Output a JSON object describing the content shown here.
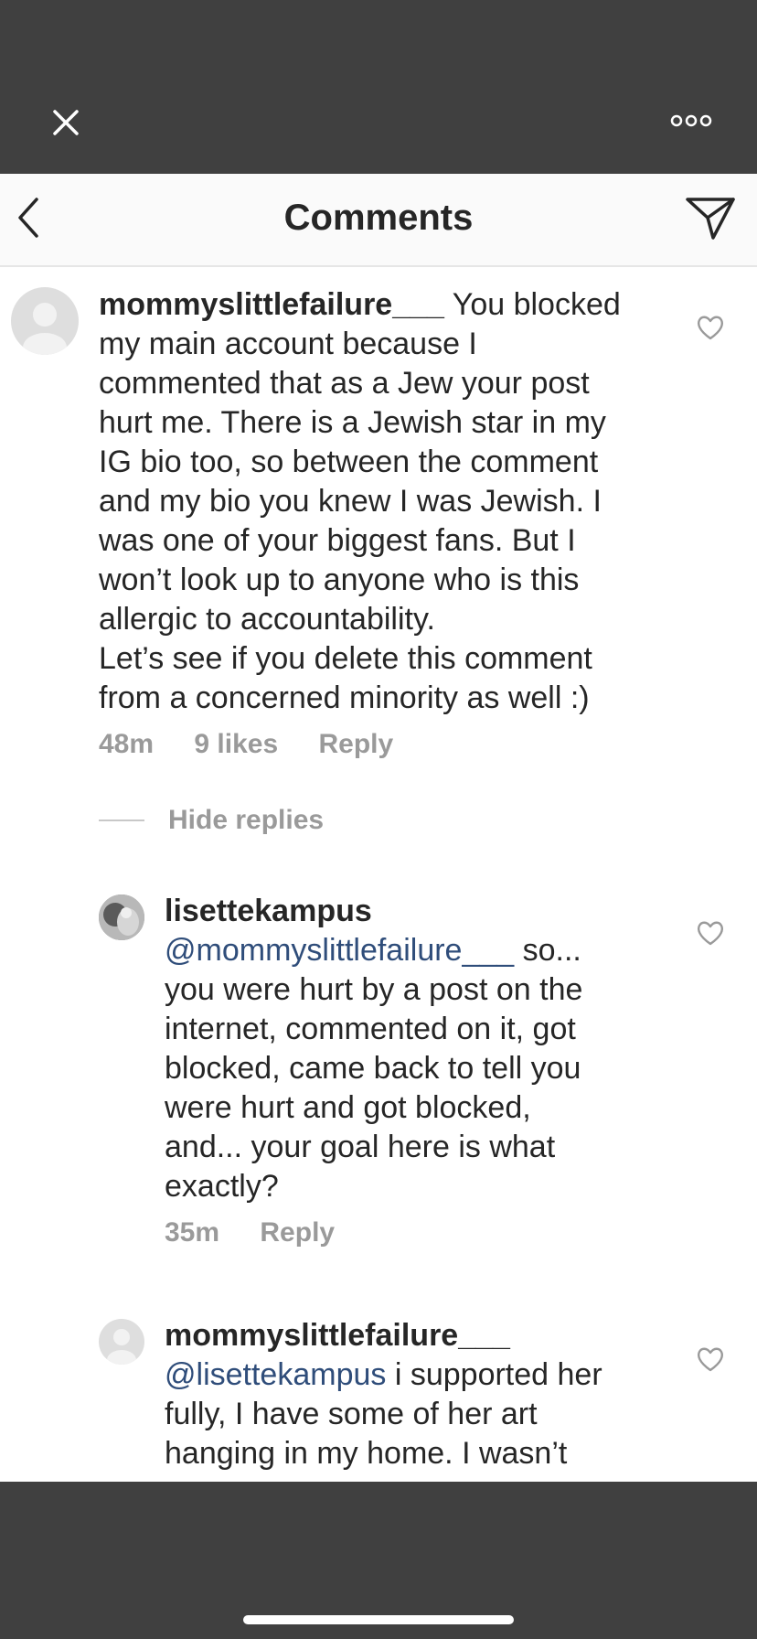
{
  "header": {
    "title": "Comments"
  },
  "comments": [
    {
      "username": "mommyslittlefailure___",
      "text_lines": [
        " You blocked",
        "my main account because I",
        "commented that as a Jew your post",
        "hurt me. There is a Jewish star in my",
        "IG bio too, so between the comment",
        "and my bio you knew I was Jewish. I",
        "was one of your biggest fans. But I",
        "won’t look up to anyone who is this",
        "allergic to accountability.",
        "Let’s see if you delete this comment",
        "from a concerned minority as well :)"
      ],
      "time": "48m",
      "likes": "9 likes",
      "reply": "Reply"
    }
  ],
  "hide_replies": "Hide replies",
  "replies": [
    {
      "username": "lisettekampus",
      "mention": "@mommyslittlefailure___",
      "text_lines": [
        " so...",
        "you were hurt by a post on the",
        "internet, commented on it, got",
        "blocked, came back to tell you",
        "were hurt and got blocked,",
        "and... your goal here is what",
        "exactly?"
      ],
      "time": "35m",
      "reply": "Reply"
    },
    {
      "username": "mommyslittlefailure___",
      "mention": "@lisettekampus",
      "text_lines": [
        " i supported her",
        "fully, I have some of her art",
        "hanging in my home. I wasn’t"
      ]
    }
  ]
}
